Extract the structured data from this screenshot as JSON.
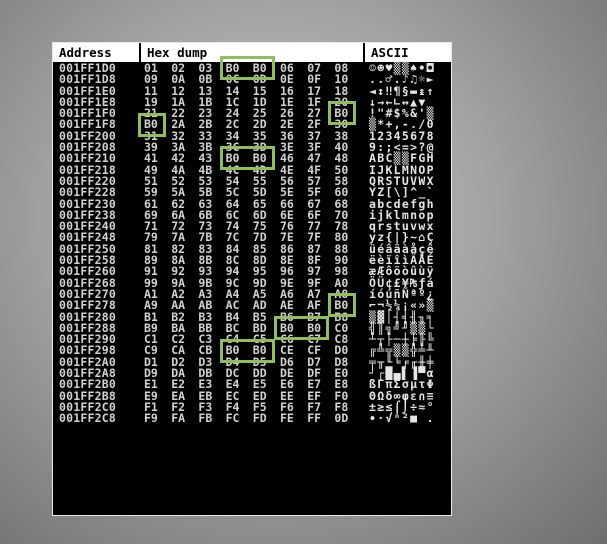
{
  "header": {
    "address": "Address",
    "hex": "Hex dump",
    "ascii": "ASCII"
  },
  "rows": [
    {
      "address": "001FF1D0",
      "bytes": [
        "01",
        "02",
        "03",
        "B0",
        "B0",
        "06",
        "07",
        "08"
      ],
      "ascii": "☺☻♥▒▒♠•◘"
    },
    {
      "address": "001FF1D8",
      "bytes": [
        "09",
        "0A",
        "0B",
        "0C",
        "0D",
        "0E",
        "0F",
        "10"
      ],
      "ascii": "..♂.♪♫☼►"
    },
    {
      "address": "001FF1E0",
      "bytes": [
        "11",
        "12",
        "13",
        "14",
        "15",
        "16",
        "17",
        "18"
      ],
      "ascii": "◄↕‼¶§▬↨↑"
    },
    {
      "address": "001FF1E8",
      "bytes": [
        "19",
        "1A",
        "1B",
        "1C",
        "1D",
        "1E",
        "1F",
        "20"
      ],
      "ascii": "↓→←∟↔▲▼ "
    },
    {
      "address": "001FF1F0",
      "bytes": [
        "21",
        "22",
        "23",
        "24",
        "25",
        "26",
        "27",
        "B0"
      ],
      "ascii": "!\"#$%&'▒"
    },
    {
      "address": "001FF1F8",
      "bytes": [
        "B0",
        "2A",
        "2B",
        "2C",
        "2D",
        "2E",
        "2F",
        "30"
      ],
      "ascii": "▒*+,-./0"
    },
    {
      "address": "001FF200",
      "bytes": [
        "31",
        "32",
        "33",
        "34",
        "35",
        "36",
        "37",
        "38"
      ],
      "ascii": "12345678"
    },
    {
      "address": "001FF208",
      "bytes": [
        "39",
        "3A",
        "3B",
        "3C",
        "3D",
        "3E",
        "3F",
        "40"
      ],
      "ascii": "9:;<=>?@"
    },
    {
      "address": "001FF210",
      "bytes": [
        "41",
        "42",
        "43",
        "B0",
        "B0",
        "46",
        "47",
        "48"
      ],
      "ascii": "ABC▒▒FGH"
    },
    {
      "address": "001FF218",
      "bytes": [
        "49",
        "4A",
        "4B",
        "4C",
        "4D",
        "4E",
        "4F",
        "50"
      ],
      "ascii": "IJKLMNOP"
    },
    {
      "address": "001FF220",
      "bytes": [
        "51",
        "52",
        "53",
        "54",
        "55",
        "56",
        "57",
        "58"
      ],
      "ascii": "QRSTUVWX"
    },
    {
      "address": "001FF228",
      "bytes": [
        "59",
        "5A",
        "5B",
        "5C",
        "5D",
        "5E",
        "5F",
        "60"
      ],
      "ascii": "YZ[\\]^_`"
    },
    {
      "address": "001FF230",
      "bytes": [
        "61",
        "62",
        "63",
        "64",
        "65",
        "66",
        "67",
        "68"
      ],
      "ascii": "abcdefgh"
    },
    {
      "address": "001FF238",
      "bytes": [
        "69",
        "6A",
        "6B",
        "6C",
        "6D",
        "6E",
        "6F",
        "70"
      ],
      "ascii": "ijklmnop"
    },
    {
      "address": "001FF240",
      "bytes": [
        "71",
        "72",
        "73",
        "74",
        "75",
        "76",
        "77",
        "78"
      ],
      "ascii": "qrstuvwx"
    },
    {
      "address": "001FF248",
      "bytes": [
        "79",
        "7A",
        "7B",
        "7C",
        "7D",
        "7E",
        "7F",
        "80"
      ],
      "ascii": "yz{|}~⌂Ç"
    },
    {
      "address": "001FF250",
      "bytes": [
        "81",
        "82",
        "83",
        "84",
        "85",
        "86",
        "87",
        "88"
      ],
      "ascii": "üéâäàåçê"
    },
    {
      "address": "001FF258",
      "bytes": [
        "89",
        "8A",
        "8B",
        "8C",
        "8D",
        "8E",
        "8F",
        "90"
      ],
      "ascii": "ëèïîìÄÅÉ"
    },
    {
      "address": "001FF260",
      "bytes": [
        "91",
        "92",
        "93",
        "94",
        "95",
        "96",
        "97",
        "98"
      ],
      "ascii": "æÆôöòûùÿ"
    },
    {
      "address": "001FF268",
      "bytes": [
        "99",
        "9A",
        "9B",
        "9C",
        "9D",
        "9E",
        "9F",
        "A0"
      ],
      "ascii": "ÖÜ¢£¥₧ƒá"
    },
    {
      "address": "001FF270",
      "bytes": [
        "A1",
        "A2",
        "A3",
        "A4",
        "A5",
        "A6",
        "A7",
        "A8"
      ],
      "ascii": "íóúñÑªº¿"
    },
    {
      "address": "001FF278",
      "bytes": [
        "A9",
        "AA",
        "AB",
        "AC",
        "AD",
        "AE",
        "AF",
        "B0"
      ],
      "ascii": "⌐¬½¼¡«»▒"
    },
    {
      "address": "001FF280",
      "bytes": [
        "B1",
        "B2",
        "B3",
        "B4",
        "B5",
        "B6",
        "B7",
        "B8"
      ],
      "ascii": "▒▓│┤╡╢╖╕"
    },
    {
      "address": "001FF288",
      "bytes": [
        "B9",
        "BA",
        "BB",
        "BC",
        "BD",
        "B0",
        "B0",
        "C0"
      ],
      "ascii": "╣║╗╝╜▒▒└"
    },
    {
      "address": "001FF290",
      "bytes": [
        "C1",
        "C2",
        "C3",
        "C4",
        "C5",
        "C6",
        "C7",
        "C8"
      ],
      "ascii": "┴┬├─┼╞╟╚"
    },
    {
      "address": "001FF298",
      "bytes": [
        "C9",
        "CA",
        "CB",
        "B0",
        "B0",
        "CE",
        "CF",
        "D0"
      ],
      "ascii": "╔╩╦▒▒╬╧╨"
    },
    {
      "address": "001FF2A0",
      "bytes": [
        "D1",
        "D2",
        "D3",
        "D4",
        "D5",
        "D6",
        "D7",
        "D8"
      ],
      "ascii": "╤╥╙╘╒╓╫╪"
    },
    {
      "address": "001FF2A8",
      "bytes": [
        "D9",
        "DA",
        "DB",
        "DC",
        "DD",
        "DE",
        "DF",
        "E0"
      ],
      "ascii": "┘┌█▄▌▐▀α"
    },
    {
      "address": "001FF2B0",
      "bytes": [
        "E1",
        "E2",
        "E3",
        "E4",
        "E5",
        "E6",
        "E7",
        "E8"
      ],
      "ascii": "ßΓπΣσµτΦ"
    },
    {
      "address": "001FF2B8",
      "bytes": [
        "E9",
        "EA",
        "EB",
        "EC",
        "ED",
        "EE",
        "EF",
        "F0"
      ],
      "ascii": "ΘΩδ∞φε∩≡"
    },
    {
      "address": "001FF2C0",
      "bytes": [
        "F1",
        "F2",
        "F3",
        "F4",
        "F5",
        "F6",
        "F7",
        "F8"
      ],
      "ascii": "±≥≤⌠⌡÷≈°"
    },
    {
      "address": "001FF2C8",
      "bytes": [
        "F9",
        "FA",
        "FB",
        "FC",
        "FD",
        "FE",
        "FF",
        "0D"
      ],
      "ascii": "∙·√ⁿ²■ ."
    }
  ],
  "highlighted_bytes": [
    {
      "row": 0,
      "start": 3,
      "end": 4
    },
    {
      "row": 4,
      "start": 7,
      "end": 7
    },
    {
      "row": 5,
      "start": 0,
      "end": 0
    },
    {
      "row": 8,
      "start": 3,
      "end": 4
    },
    {
      "row": 21,
      "start": 7,
      "end": 7
    },
    {
      "row": 23,
      "start": 5,
      "end": 6
    },
    {
      "row": 25,
      "start": 3,
      "end": 4
    }
  ],
  "colors": {
    "highlight": "#8fbf5a",
    "text": "#d2d2d2",
    "background": "#000000",
    "header": "#ffffff"
  }
}
